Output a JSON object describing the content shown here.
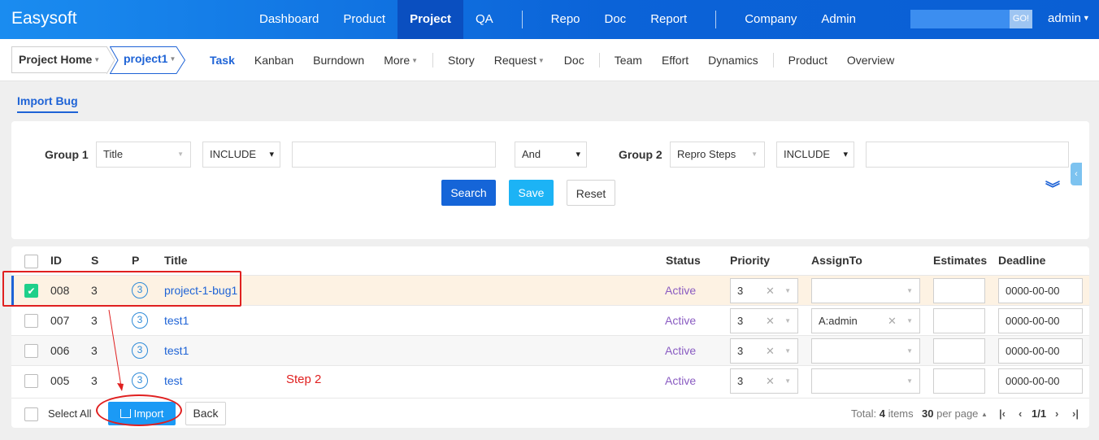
{
  "app": {
    "brand": "Easysoft"
  },
  "main_nav": {
    "items": [
      "Dashboard",
      "Product",
      "Project",
      "QA",
      "Repo",
      "Doc",
      "Report",
      "Company",
      "Admin"
    ],
    "active": "Project"
  },
  "top_right": {
    "go_label": "GO!",
    "user": "admin"
  },
  "breadcrumb": {
    "home": "Project Home",
    "project": "project1"
  },
  "sub_nav": {
    "items": [
      "Task",
      "Kanban",
      "Burndown",
      "More",
      "Story",
      "Request",
      "Doc",
      "Team",
      "Effort",
      "Dynamics",
      "Product",
      "Overview"
    ],
    "active": "Task"
  },
  "page_tab": "Import Bug",
  "search": {
    "group1_label": "Group 1",
    "group1_field": "Title",
    "group1_operator": "INCLUDE",
    "group1_value": "",
    "logic": "And",
    "group2_label": "Group 2",
    "group2_field": "Repro Steps",
    "group2_operator": "INCLUDE",
    "group2_value": "",
    "search_btn": "Search",
    "save_btn": "Save",
    "reset_btn": "Reset"
  },
  "table": {
    "headers": [
      "ID",
      "S",
      "P",
      "Title",
      "Status",
      "Priority",
      "AssignTo",
      "Estimates",
      "Deadline"
    ],
    "rows": [
      {
        "id": "008",
        "s": "3",
        "p": "3",
        "title": "project-1-bug1",
        "status": "Active",
        "priority": "3",
        "assign": "",
        "estimates": "",
        "deadline": "0000-00-00",
        "checked": true
      },
      {
        "id": "007",
        "s": "3",
        "p": "3",
        "title": "test1",
        "status": "Active",
        "priority": "3",
        "assign": "A:admin",
        "estimates": "",
        "deadline": "0000-00-00",
        "checked": false
      },
      {
        "id": "006",
        "s": "3",
        "p": "3",
        "title": "test1",
        "status": "Active",
        "priority": "3",
        "assign": "",
        "estimates": "",
        "deadline": "0000-00-00",
        "checked": false
      },
      {
        "id": "005",
        "s": "3",
        "p": "3",
        "title": "test",
        "status": "Active",
        "priority": "3",
        "assign": "",
        "estimates": "",
        "deadline": "0000-00-00",
        "checked": false
      }
    ]
  },
  "footer": {
    "select_all": "Select All",
    "import_btn": "Import",
    "back_btn": "Back",
    "total_prefix": "Total:",
    "total_count": "4",
    "total_suffix": "items",
    "per_page_count": "30",
    "per_page_suffix": "per page",
    "page": "1/1"
  },
  "annotation": {
    "step_label": "Step 2"
  },
  "colors": {
    "accent": "#1e63d6",
    "topbar": "#0b63d8",
    "save": "#1cb3f5",
    "status": "#8a5cc2",
    "annotation": "#e02020",
    "checked": "#1ed08a"
  }
}
